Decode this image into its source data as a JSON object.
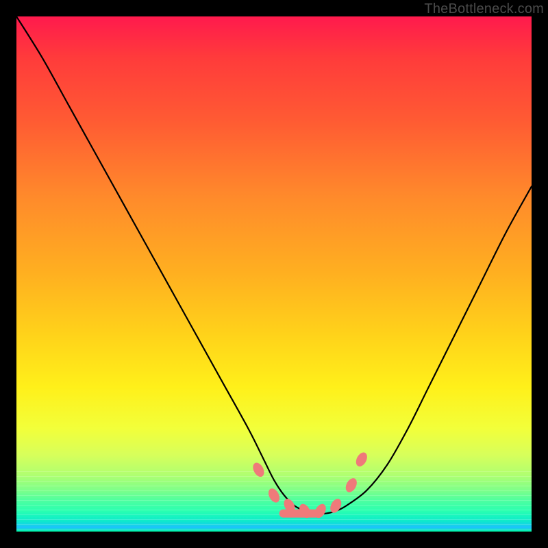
{
  "watermark": "TheBottleneck.com",
  "chart_data": {
    "type": "line",
    "title": "",
    "xlabel": "",
    "ylabel": "",
    "xlim": [
      0,
      100
    ],
    "ylim": [
      0,
      100
    ],
    "grid": false,
    "legend": false,
    "series": [
      {
        "name": "bottleneck-curve",
        "color": "#000000",
        "x": [
          0,
          5,
          10,
          15,
          20,
          25,
          30,
          35,
          40,
          45,
          48,
          50,
          52,
          54,
          56,
          58,
          60,
          62,
          64,
          68,
          72,
          76,
          80,
          85,
          90,
          95,
          100
        ],
        "y": [
          100,
          92,
          83,
          74,
          65,
          56,
          47,
          38,
          29,
          20,
          14,
          10,
          7,
          5,
          4,
          3.5,
          3.5,
          4,
          5,
          8,
          13,
          20,
          28,
          38,
          48,
          58,
          67
        ]
      },
      {
        "name": "bottleneck-markers",
        "color": "#ef7a7a",
        "type": "scatter",
        "x": [
          47,
          50,
          53,
          56,
          59,
          62,
          65,
          67
        ],
        "y": [
          12,
          7,
          5,
          4,
          4,
          5,
          9,
          14
        ]
      }
    ]
  }
}
